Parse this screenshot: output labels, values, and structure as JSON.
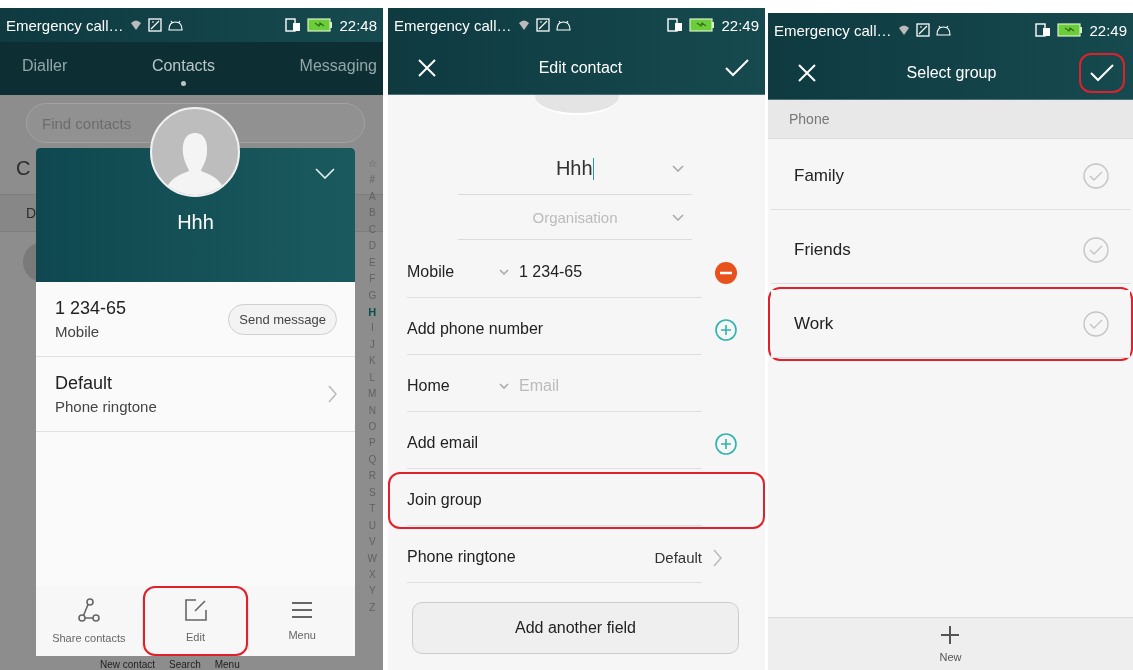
{
  "contacts_screen": {
    "status_bar": {
      "notification": "Emergency call…",
      "time": "22:48"
    },
    "tabs": [
      {
        "label": "Dialler",
        "selected": false
      },
      {
        "label": "Contacts",
        "selected": true
      },
      {
        "label": "Messaging",
        "selected": false
      }
    ],
    "search": {
      "placeholder": "Find contacts"
    },
    "background_rows": [
      "C",
      "D"
    ],
    "index": [
      {
        "label": "☆",
        "selected": false
      },
      {
        "label": "#",
        "selected": false
      },
      {
        "label": "A",
        "selected": false
      },
      {
        "label": "B",
        "selected": false
      },
      {
        "label": "C",
        "selected": false
      },
      {
        "label": "D",
        "selected": false
      },
      {
        "label": "E",
        "selected": false
      },
      {
        "label": "F",
        "selected": false
      },
      {
        "label": "G",
        "selected": false
      },
      {
        "label": "H",
        "selected": true
      },
      {
        "label": "I",
        "selected": false
      },
      {
        "label": "J",
        "selected": false
      },
      {
        "label": "K",
        "selected": false
      },
      {
        "label": "L",
        "selected": false
      },
      {
        "label": "M",
        "selected": false
      },
      {
        "label": "N",
        "selected": false
      },
      {
        "label": "O",
        "selected": false
      },
      {
        "label": "P",
        "selected": false
      },
      {
        "label": "Q",
        "selected": false
      },
      {
        "label": "R",
        "selected": false
      },
      {
        "label": "S",
        "selected": false
      },
      {
        "label": "T",
        "selected": false
      },
      {
        "label": "U",
        "selected": false
      },
      {
        "label": "V",
        "selected": false
      },
      {
        "label": "W",
        "selected": false
      },
      {
        "label": "X",
        "selected": false
      },
      {
        "label": "Y",
        "selected": false
      },
      {
        "label": "Z",
        "selected": false
      }
    ],
    "background_bar": [
      "New contact",
      "Search",
      "Menu"
    ],
    "card": {
      "name": "Hhh",
      "phone": {
        "number": "1 234-65",
        "type": "Mobile",
        "button": "Send message"
      },
      "ringtone": {
        "value": "Default",
        "label": "Phone ringtone"
      },
      "actions": [
        {
          "kind": "share",
          "label": "Share contacts",
          "highlighted": false
        },
        {
          "kind": "edit",
          "label": "Edit",
          "highlighted": true
        },
        {
          "kind": "menu",
          "label": "Menu",
          "highlighted": false
        }
      ]
    }
  },
  "edit_screen": {
    "status_bar": {
      "notification": "Emergency call…",
      "time": "22:49"
    },
    "title": "Edit contact",
    "name": {
      "value": "Hhh"
    },
    "organisation": {
      "placeholder": "Organisation"
    },
    "fields": [
      {
        "kind": "entry",
        "label": "Mobile",
        "value": "1 234-65",
        "removable": true,
        "highlighted": false
      },
      {
        "kind": "add",
        "label": "Add phone number",
        "highlighted": false
      },
      {
        "kind": "entry",
        "label": "Home",
        "placeholder": "Email",
        "removable": false,
        "highlighted": false
      },
      {
        "kind": "add",
        "label": "Add email",
        "highlighted": false
      },
      {
        "kind": "link",
        "label": "Join group",
        "highlighted": true
      },
      {
        "kind": "link",
        "label": "Phone ringtone",
        "value": "Default",
        "highlighted": false
      }
    ],
    "add_field_button": "Add another field"
  },
  "group_screen": {
    "status_bar": {
      "notification": "Emergency call…",
      "time": "22:49"
    },
    "title": "Select group",
    "confirm": {
      "highlighted": true
    },
    "section": "Phone",
    "groups": [
      {
        "label": "Family",
        "checked": false,
        "highlighted": false
      },
      {
        "label": "Friends",
        "checked": false,
        "highlighted": false
      },
      {
        "label": "Work",
        "checked": false,
        "highlighted": true
      }
    ],
    "new_button": "New"
  }
}
